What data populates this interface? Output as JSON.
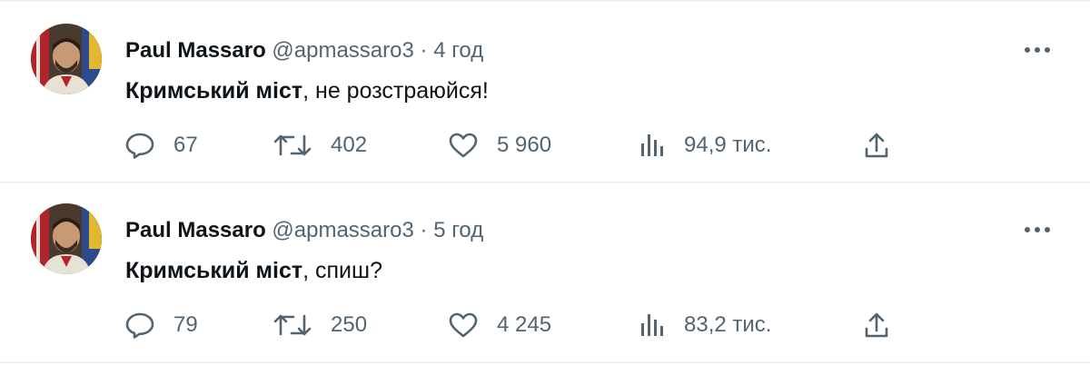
{
  "tweets": [
    {
      "author_name": "Paul Massaro",
      "author_handle": "@apmassaro3",
      "separator": "·",
      "time": "4 год",
      "text_bold": "Кримський міст",
      "text_rest": ", не розстраюйся!",
      "replies": "67",
      "retweets": "402",
      "likes": "5 960",
      "views": "94,9 тис."
    },
    {
      "author_name": "Paul Massaro",
      "author_handle": "@apmassaro3",
      "separator": "·",
      "time": "5 год",
      "text_bold": "Кримський міст",
      "text_rest": ", спиш?",
      "replies": "79",
      "retweets": "250",
      "likes": "4 245",
      "views": "83,2 тис."
    }
  ],
  "icons": {
    "reply": "reply-icon",
    "retweet": "retweet-icon",
    "like": "like-icon",
    "views": "views-icon",
    "share": "share-icon",
    "more": "more-icon"
  },
  "colors": {
    "text_primary": "#0f1419",
    "text_secondary": "#536471",
    "divider": "#eff3f4"
  }
}
